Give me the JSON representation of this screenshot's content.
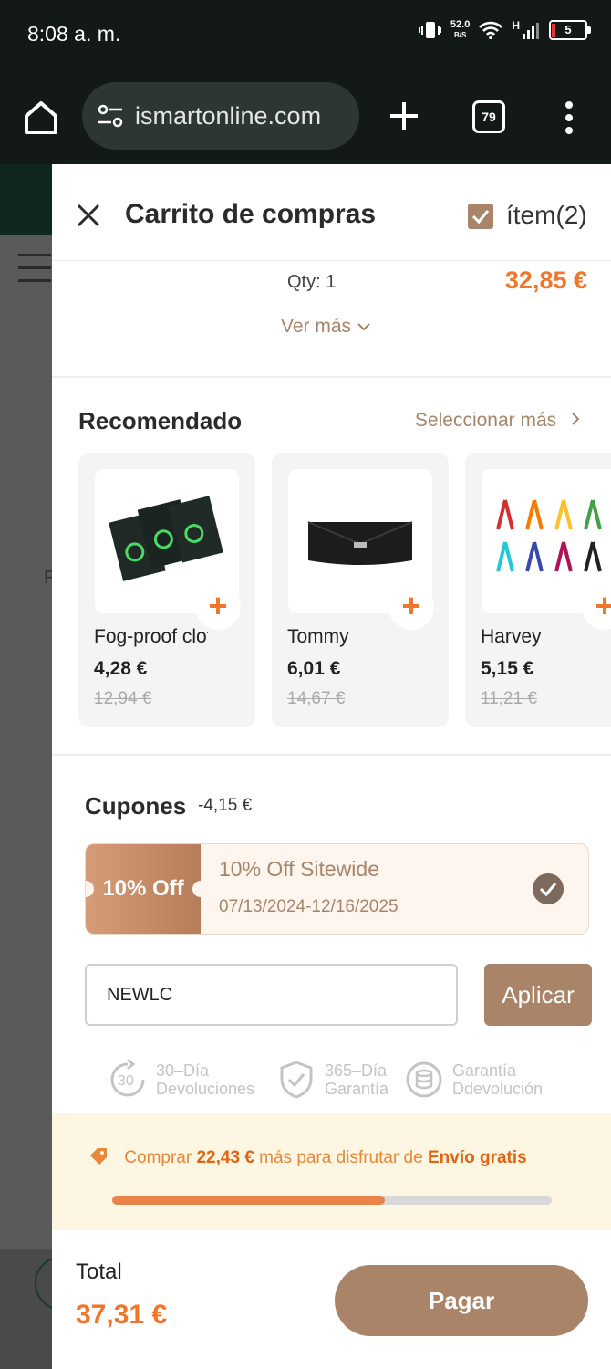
{
  "status_bar": {
    "time": "8:08 a. m.",
    "net_speed": "52.0",
    "net_unit": "B/S",
    "signal_type": "H",
    "battery": "5"
  },
  "browser": {
    "url": "ismartonline.com",
    "tab_count": "79"
  },
  "background_page": {
    "partial_letter": "F"
  },
  "cart": {
    "title": "Carrito de compras",
    "item_count": "ítem(2)",
    "qty": "Qty: 1",
    "item_price": "32,85 €",
    "see_more": "Ver más",
    "recommended": {
      "title": "Recomendado",
      "select_more": "Seleccionar más",
      "items": [
        {
          "name": "Fog-proof cloth",
          "price": "4,28 €",
          "old_price": "12,94 €"
        },
        {
          "name": "Tommy",
          "price": "6,01 €",
          "old_price": "14,67 €"
        },
        {
          "name": "Harvey",
          "price": "5,15 €",
          "old_price": "11,21 €"
        }
      ]
    },
    "coupons": {
      "title": "Cupones",
      "discount": "-4,15 €",
      "badge": "10% Off",
      "name": "10% Off Sitewide",
      "dates": "07/13/2024-12/16/2025",
      "code_value": "NEWLC",
      "apply_label": "Aplicar"
    },
    "guarantees": [
      {
        "icon": "return-30-icon",
        "line1": "30–Día",
        "line2": "Devoluciones"
      },
      {
        "icon": "shield-check-icon",
        "line1": "365–Día",
        "line2": "Garantía"
      },
      {
        "icon": "refund-coins-icon",
        "line1": "Garantía",
        "line2": "Ddevolución"
      }
    ],
    "shipping": {
      "prefix": "Comprar",
      "amount": "22,43 €",
      "middle": "más para disfrutar de",
      "highlight": "Envío gratis",
      "progress_percent": 62
    },
    "total_label": "Total",
    "total_value": "37,31 €",
    "pay_label": "Pagar"
  },
  "colors": {
    "accent": "#a98468",
    "price": "#f0762b",
    "dark_bar": "#121917"
  }
}
